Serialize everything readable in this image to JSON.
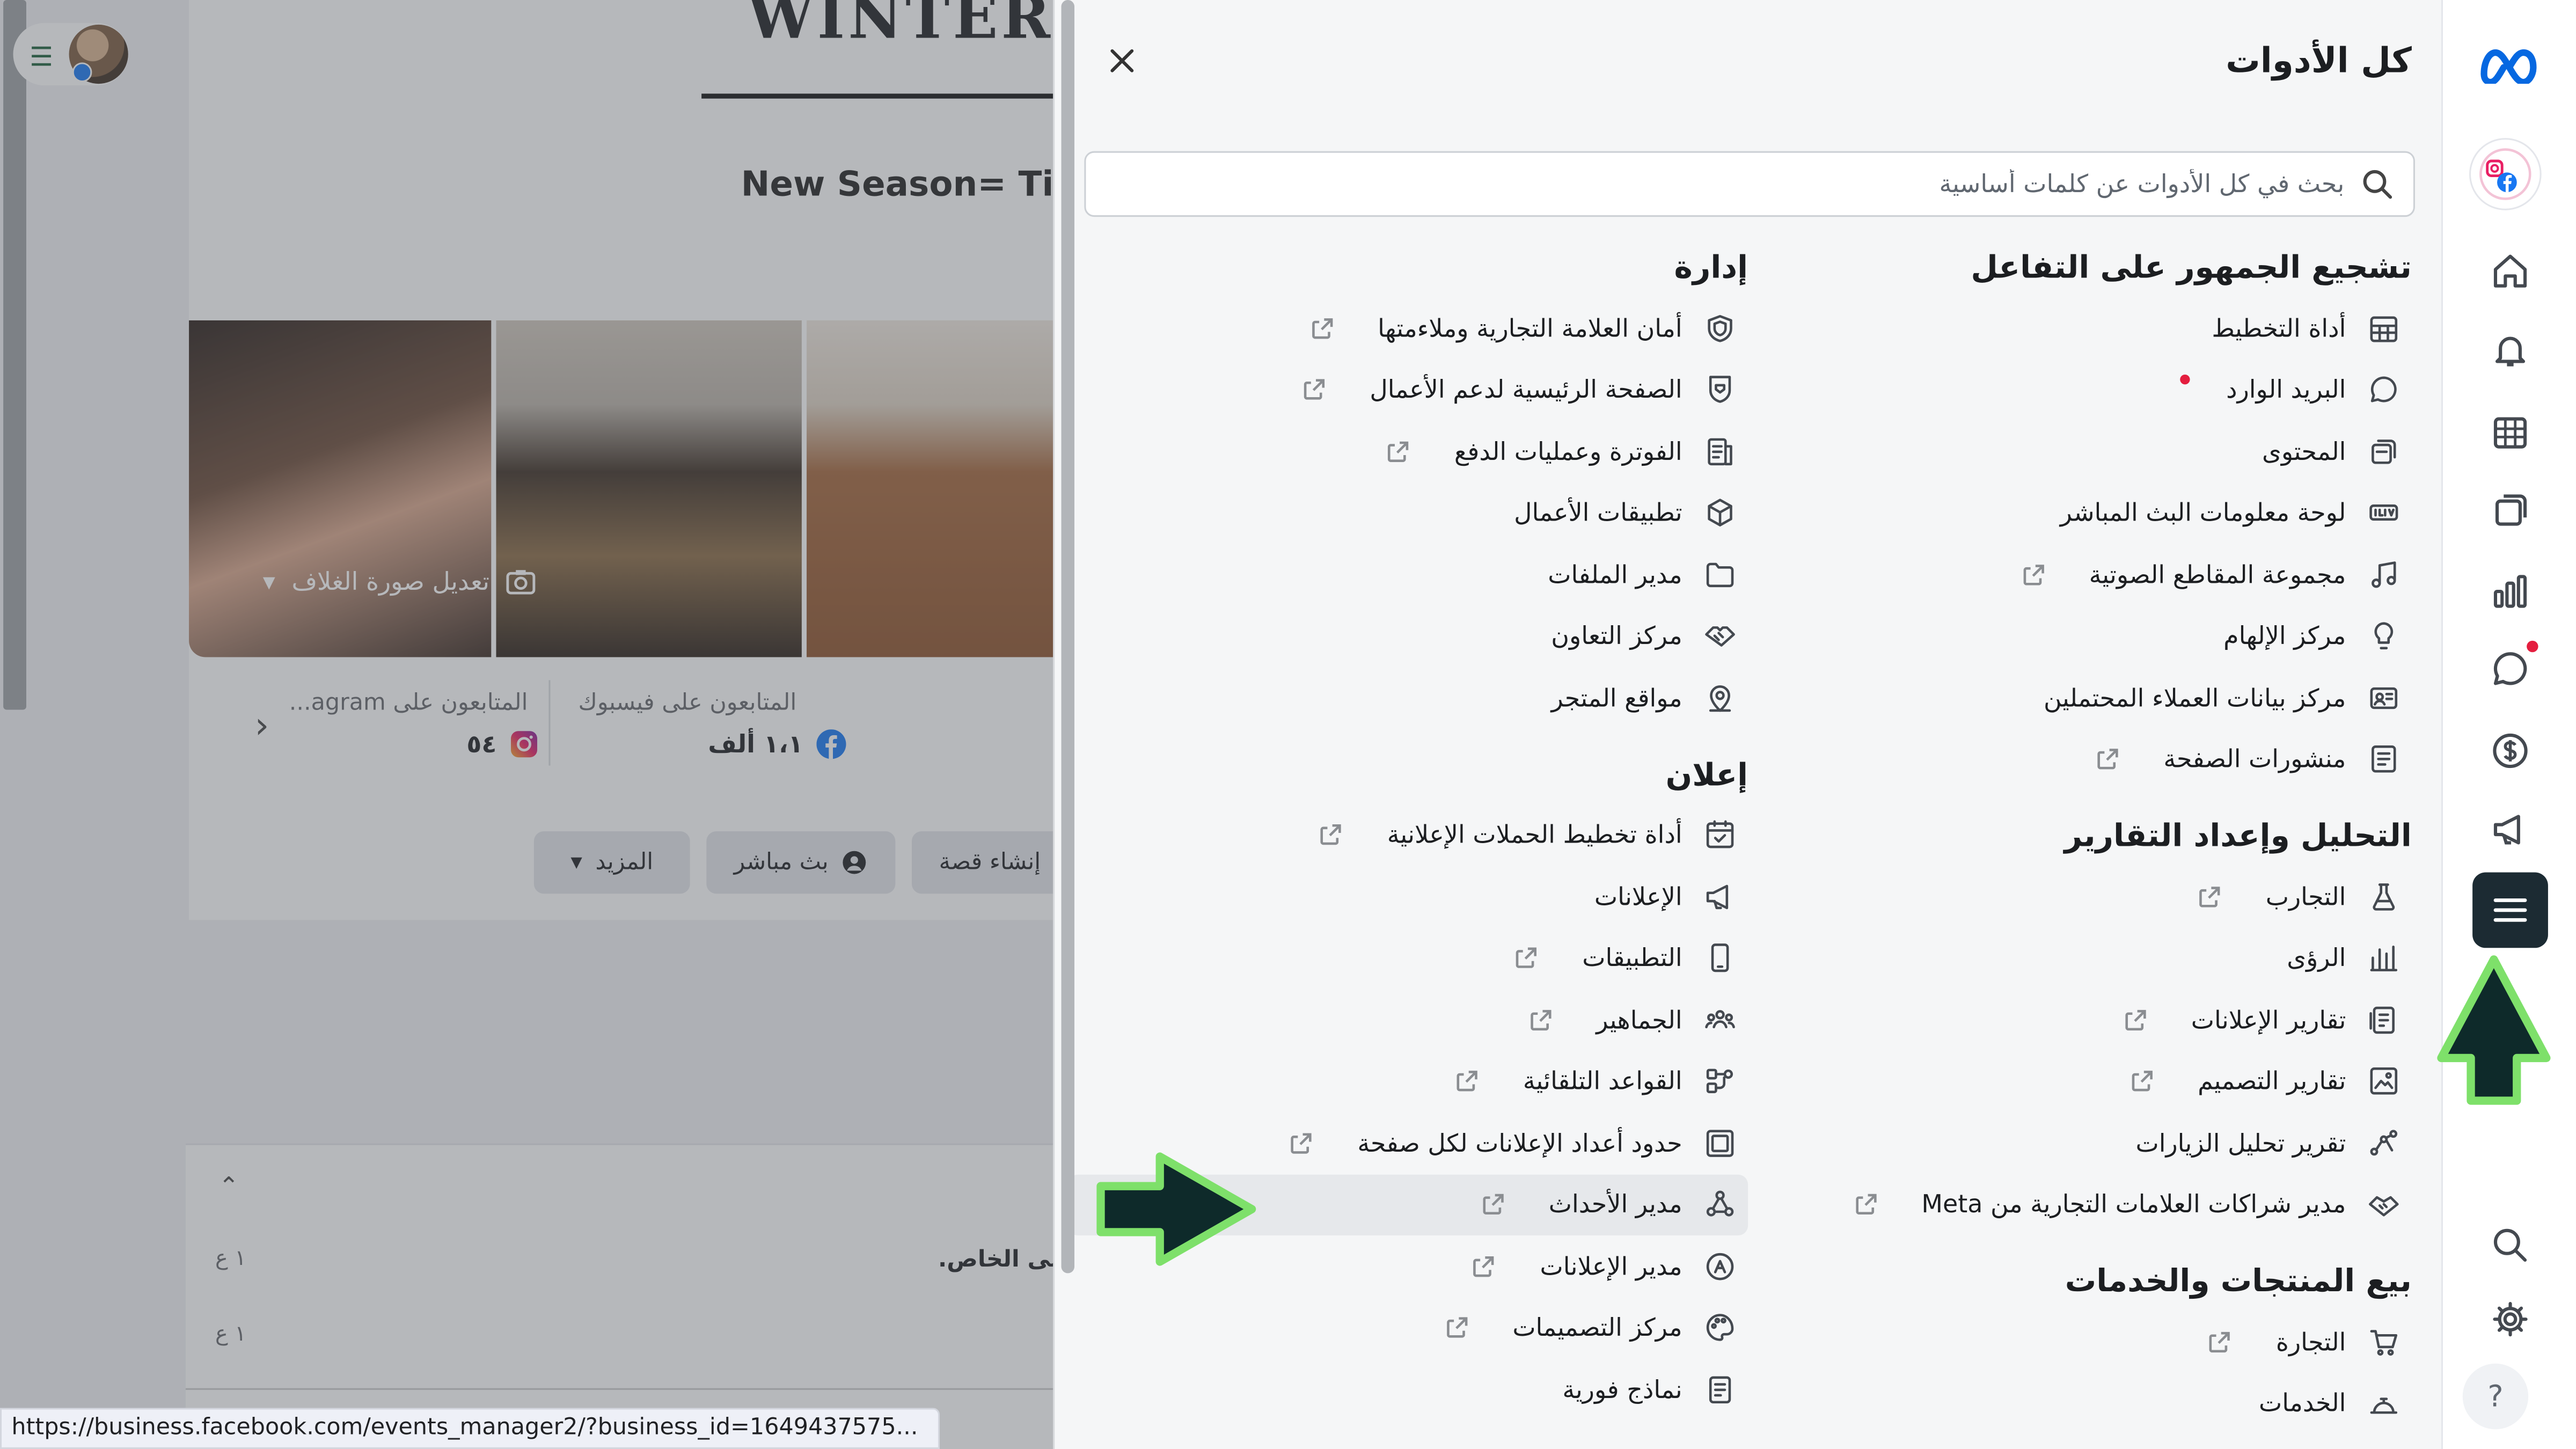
{
  "background_page": {
    "cover_title": "WINTER C",
    "subtitle": "New Season= Tim",
    "edit_cover": "تعديل صورة الغلاف",
    "followers_facebook_label": "المتابعون على فيسبوك",
    "followers_facebook_value": "١،١ ألف",
    "followers_instagram_label": "المتابعون على agram...",
    "followers_instagram_value": "٥٤",
    "buttons": {
      "create_story": "إنشاء قصة",
      "live": "بث مباشر",
      "more": "المزيد"
    },
    "message_preview": "لى الخاص.",
    "time_1": "١ ع",
    "time_2": "١ ع"
  },
  "status_url": "https://business.facebook.com/events_manager2/?business_id=1649437575...",
  "panel": {
    "title": "كل الأدوات",
    "search_placeholder": "بحث في كل الأدوات عن كلمات أساسية",
    "right_column": [
      {
        "title": "تشجيع الجمهور على التفاعل",
        "items": [
          {
            "label": "أداة التخطيط",
            "icon": "planner-icon",
            "external": false
          },
          {
            "label": "البريد الوارد",
            "icon": "inbox-icon",
            "external": false,
            "dot": true
          },
          {
            "label": "المحتوى",
            "icon": "content-icon",
            "external": false
          },
          {
            "label": "لوحة معلومات البث المباشر",
            "icon": "live-icon",
            "external": false
          },
          {
            "label": "مجموعة المقاطع الصوتية",
            "icon": "music-icon",
            "external": true
          },
          {
            "label": "مركز الإلهام",
            "icon": "lightbulb-icon",
            "external": false
          },
          {
            "label": "مركز بيانات العملاء المحتملين",
            "icon": "leads-icon",
            "external": false
          },
          {
            "label": "منشورات الصفحة",
            "icon": "page-posts-icon",
            "external": true
          }
        ]
      },
      {
        "title": "التحليل وإعداد التقارير",
        "items": [
          {
            "label": "التجارب",
            "icon": "flask-icon",
            "external": true
          },
          {
            "label": "الرؤى",
            "icon": "insights-icon",
            "external": false
          },
          {
            "label": "تقارير الإعلانات",
            "icon": "ad-reports-icon",
            "external": true
          },
          {
            "label": "تقارير التصميم",
            "icon": "creative-reports-icon",
            "external": true
          },
          {
            "label": "تقرير تحليل الزيارات",
            "icon": "attribution-icon",
            "external": false
          },
          {
            "label": "مدير شراكات العلامات التجارية من Meta",
            "icon": "handshake-icon",
            "external": true
          }
        ]
      },
      {
        "title": "بيع المنتجات والخدمات",
        "items": [
          {
            "label": "التجارة",
            "icon": "cart-icon",
            "external": true
          },
          {
            "label": "الخدمات",
            "icon": "services-icon",
            "external": false
          }
        ]
      }
    ],
    "left_column": [
      {
        "title": "إدارة",
        "items": [
          {
            "label": "أمان العلامة التجارية وملاءمتها",
            "icon": "shield-icon",
            "external": true
          },
          {
            "label": "الصفحة الرئيسية لدعم الأعمال",
            "icon": "support-shield-icon",
            "external": true
          },
          {
            "label": "الفوترة وعمليات الدفع",
            "icon": "billing-icon",
            "external": true
          },
          {
            "label": "تطبيقات الأعمال",
            "icon": "cube-icon",
            "external": false
          },
          {
            "label": "مدير الملفات",
            "icon": "folder-icon",
            "external": false
          },
          {
            "label": "مركز التعاون",
            "icon": "collab-icon",
            "external": false
          },
          {
            "label": "مواقع المتجر",
            "icon": "location-icon",
            "external": false
          }
        ]
      },
      {
        "title": "إعلان",
        "items": [
          {
            "label": "أداة تخطيط الحملات الإعلانية",
            "icon": "calendar-check-icon",
            "external": true
          },
          {
            "label": "الإعلانات",
            "icon": "megaphone-icon",
            "external": false
          },
          {
            "label": "التطبيقات",
            "icon": "phone-icon",
            "external": true
          },
          {
            "label": "الجماهير",
            "icon": "audiences-icon",
            "external": true
          },
          {
            "label": "القواعد التلقائية",
            "icon": "rules-icon",
            "external": true
          },
          {
            "label": "حدود أعداد الإعلانات لكل صفحة",
            "icon": "ad-limits-icon",
            "external": true
          },
          {
            "label": "مدير الأحداث",
            "icon": "events-manager-icon",
            "external": true,
            "highlighted": true
          },
          {
            "label": "مدير الإعلانات",
            "icon": "ads-manager-icon",
            "external": true
          },
          {
            "label": "مركز التصميمات",
            "icon": "palette-icon",
            "external": true
          },
          {
            "label": "نماذج فورية",
            "icon": "form-icon",
            "external": false
          }
        ]
      }
    ]
  },
  "colors": {
    "rail_active_bg": "#1c2b33",
    "notification_dot": "#e41e3f",
    "arrow_fill": "#0e2a2a",
    "arrow_outline": "#7ee06a",
    "meta_blue": "#0668e1",
    "facebook_blue": "#1877f2"
  }
}
